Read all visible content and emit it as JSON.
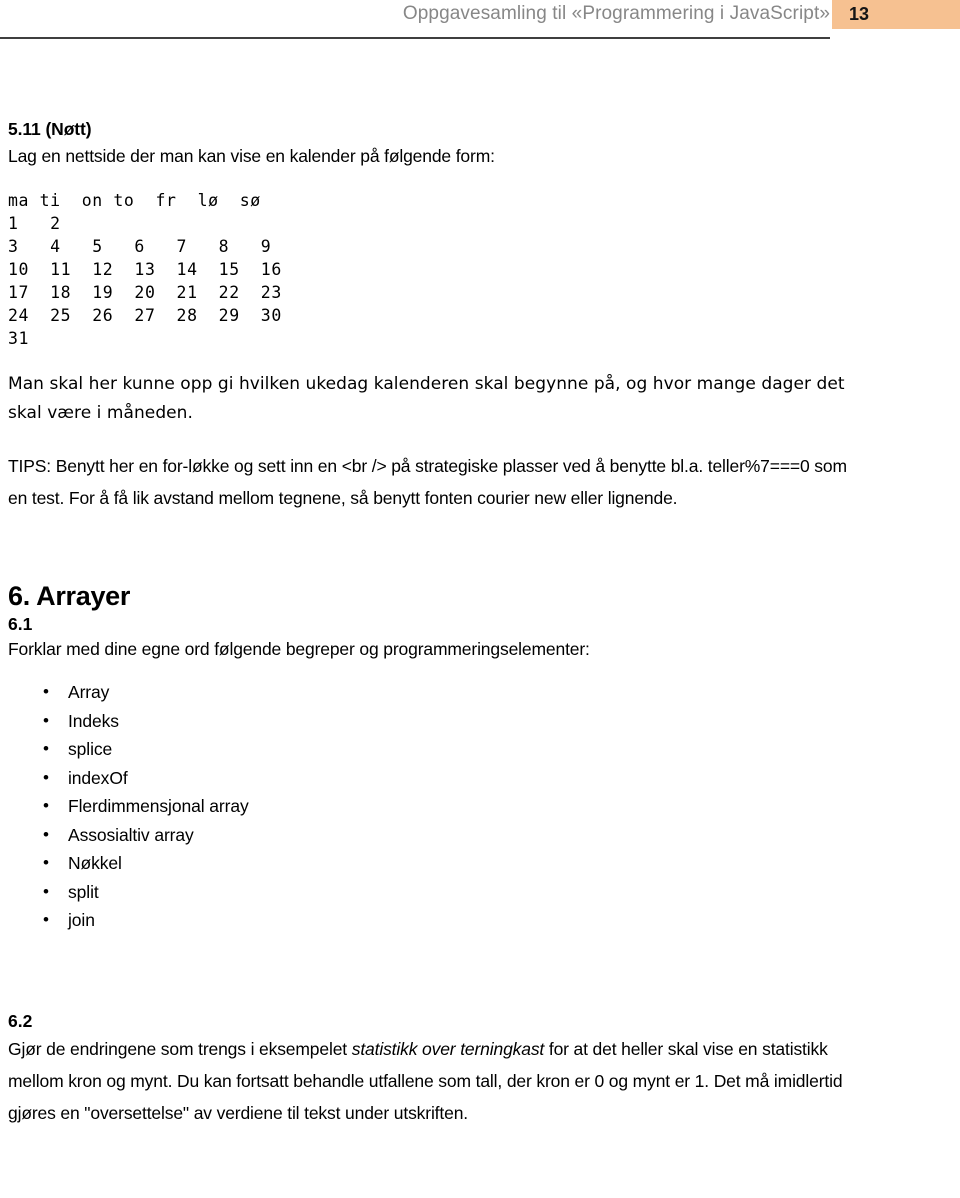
{
  "header": {
    "title": "Oppgavesamling til «Programmering i JavaScript»",
    "page_number": "13",
    "badge_color": "#f6c191",
    "title_color": "#878787",
    "rule_color": "#3f3f3f"
  },
  "exercise_5_11": {
    "heading": "5.11 (Nøtt)",
    "intro": "Lag en nettside der man kan vise en kalender på følgende form:",
    "calendar_block": "ma ti  on to  fr  lø  sø\n1   2\n3   4   5   6   7   8   9\n10  11  12  13  14  15  16\n17  18  19  20  21  22  23\n24  25  26  27  28  29  30\n31",
    "calendar_rows": [
      [
        "ma",
        "ti",
        "on",
        "to",
        "fr",
        "lø",
        "sø"
      ],
      [
        "1",
        "2",
        "",
        "",
        "",
        "",
        ""
      ],
      [
        "3",
        "4",
        "5",
        "6",
        "7",
        "8",
        "9"
      ],
      [
        "10",
        "11",
        "12",
        "13",
        "14",
        "15",
        "16"
      ],
      [
        "17",
        "18",
        "19",
        "20",
        "21",
        "22",
        "23"
      ],
      [
        "24",
        "25",
        "26",
        "27",
        "28",
        "29",
        "30"
      ],
      [
        "31",
        "",
        "",
        "",
        "",
        "",
        ""
      ]
    ],
    "description": "Man skal her kunne opp gi hvilken ukedag kalenderen skal begynne på, og hvor mange dager det skal være i måneden.",
    "tips": "TIPS: Benytt her en for-løkke og sett inn en <br /> på strategiske plasser ved å benytte bl.a. teller%7===0 som en test. For å få lik avstand mellom tegnene, så benytt fonten courier new eller lignende."
  },
  "chapter_6": {
    "heading": "6. Arrayer",
    "exercise_6_1": {
      "number": "6.1",
      "intro": "Forklar med dine egne ord følgende begreper og programmeringselementer:",
      "bullet_glyph": "•",
      "items": [
        "Array",
        "Indeks",
        "splice",
        "indexOf",
        "Flerdimmensjonal array",
        "Assosialtiv array",
        "Nøkkel",
        "split",
        "join"
      ]
    },
    "exercise_6_2": {
      "number": "6.2",
      "text_part1": "Gjør de endringene som trengs i eksempelet ",
      "italic_phrase": "statistikk over terningkast",
      "text_part2": " for at det heller skal vise en statistikk mellom kron og mynt. Du kan fortsatt behandle utfallene som tall, der kron er 0 og mynt er 1. Det må imidlertid gjøres en \"oversettelse\" av verdiene til tekst under utskriften."
    }
  }
}
